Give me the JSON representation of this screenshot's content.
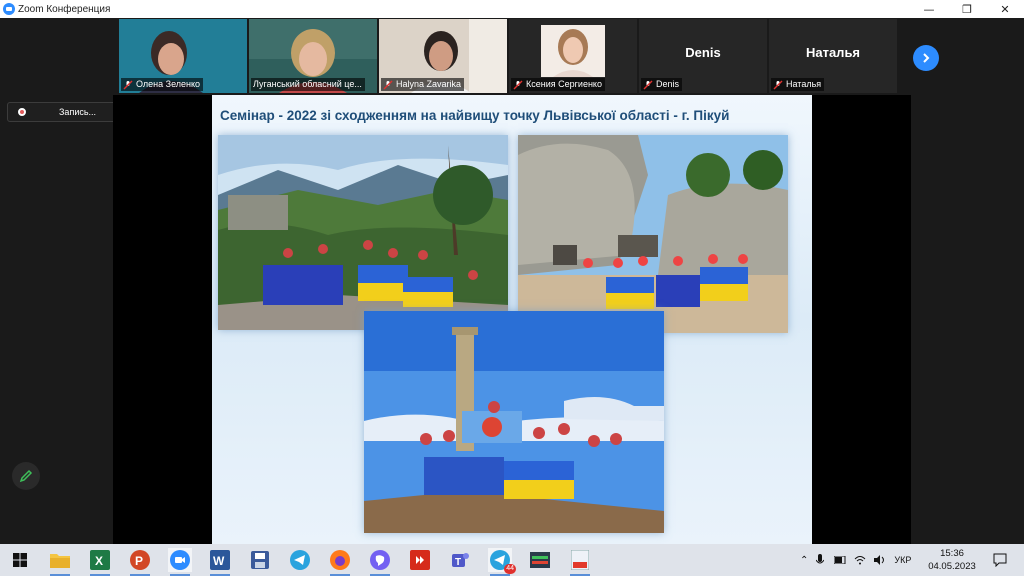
{
  "window": {
    "title": "Zoom Конференция",
    "minimize": "—",
    "restore": "❐",
    "close": "✕"
  },
  "participants": [
    {
      "name": "Олена Зеленко",
      "muted": true,
      "video": true
    },
    {
      "name": "Луганський обласний це...",
      "muted": false,
      "video": true,
      "speaking": true
    },
    {
      "name": "Halyna Zavarika",
      "muted": true,
      "video": true
    },
    {
      "name": "Ксения Сергиенко",
      "muted": true,
      "video": true
    },
    {
      "name": "Denis",
      "muted": true,
      "video": false,
      "display": "Denis"
    },
    {
      "name": "Наталья",
      "muted": true,
      "video": false,
      "display": "Наталья"
    }
  ],
  "recording": {
    "label": "Запись..."
  },
  "slide": {
    "title": "Семінар - 2022 зі сходженням на найвищу точку Львівської області - г. Пікуй"
  },
  "taskbar": {
    "apps": [
      "windows-start",
      "file-explorer",
      "excel",
      "powerpoint",
      "zoom",
      "word",
      "save-app",
      "telegram",
      "firefox",
      "viber",
      "anydesk",
      "teams",
      "telegram-desktop",
      "media-app",
      "pdf-app"
    ],
    "telegram_badge": "44",
    "language": "УКР",
    "time": "15:36",
    "date": "04.05.2023"
  },
  "colors": {
    "zoom_blue": "#2d8cff",
    "speaking_outline": "#8fd14f",
    "slide_title": "#1f4e79"
  }
}
